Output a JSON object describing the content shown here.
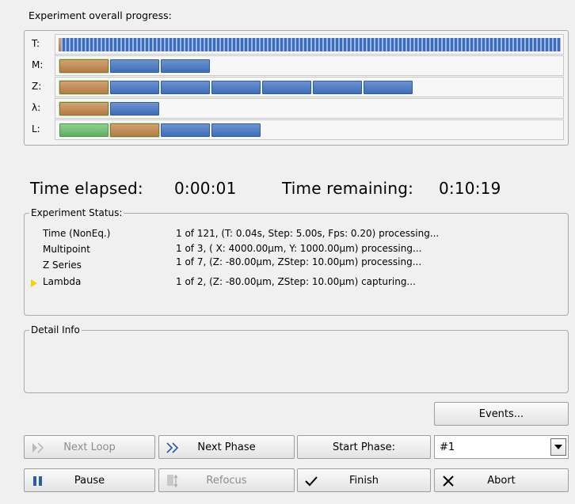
{
  "progress": {
    "title": "Experiment overall progress:",
    "rows": [
      {
        "label": "T:"
      },
      {
        "label": "M:"
      },
      {
        "label": "Z:"
      },
      {
        "label": "λ:"
      },
      {
        "label": "L:"
      }
    ]
  },
  "time": {
    "elapsed_label": "Time elapsed:",
    "elapsed_value": "0:00:01",
    "remaining_label": "Time remaining:",
    "remaining_value": "0:10:19"
  },
  "status": {
    "legend": "Experiment Status:",
    "items": [
      {
        "name": "Time (NonEq.)",
        "detail": "1 of 121, (T: 0.04s, Step: 5.00s, Fps: 0.20) processing..."
      },
      {
        "name": "Multipoint",
        "detail": "1 of 3, ( X: 4000.00µm, Y: 1000.00µm) processing..."
      },
      {
        "name": "Z Series",
        "detail": "1 of 7, (Z: -80.00µm, ZStep: 10.00µm) processing..."
      },
      {
        "name": "Lambda",
        "detail": "1 of 2, (Z: -80.00µm, ZStep: 10.00µm) capturing...",
        "active": true
      }
    ]
  },
  "detail": {
    "legend": "Detail Info"
  },
  "buttons": {
    "events": "Events...",
    "next_loop": "Next Loop",
    "next_phase": "Next Phase",
    "start_phase": "Start Phase:",
    "phase_select_value": "#1",
    "pause": "Pause",
    "refocus": "Refocus",
    "finish": "Finish",
    "abort": "Abort"
  },
  "colors": {
    "done_segment": "#b57c44",
    "pending_segment": "#3e6db8",
    "complete_segment": "#5faf5f",
    "active_marker": "#f2d400"
  },
  "icons": {
    "next_loop": "double-chevron-right-icon",
    "next_phase": "double-chevron-right-icon",
    "pause": "pause-icon",
    "refocus": "refocus-icon",
    "finish": "checkmark-icon",
    "abort": "x-icon",
    "active_step": "triangle-right-icon"
  }
}
